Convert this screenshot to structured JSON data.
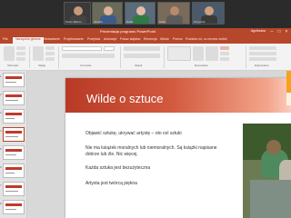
{
  "window": {
    "title": "Prezentacja programu PowerPoint",
    "user": "Agnieszka"
  },
  "videos": [
    {
      "name": "Pedro Barros"
    },
    {
      "name": "Joanna"
    },
    {
      "name": "Rafał"
    },
    {
      "name": "Dalia"
    },
    {
      "name": "Krzysztof"
    }
  ],
  "menu": {
    "tabs": [
      "Plik",
      "Narzędzia główne",
      "Wstawianie",
      "Projektowanie",
      "Przejścia",
      "Animacje",
      "Pokaz slajdów",
      "Recenzja",
      "Widok",
      "Pomoc",
      "Powiedz mi, co chcesz zrobić"
    ]
  },
  "ribbon": {
    "groups": [
      "Schowek",
      "Slajdy",
      "Czcionka",
      "Akapit",
      "Rysowanie",
      "Edytowanie"
    ]
  },
  "thumbnails": [
    "1",
    "2",
    "3",
    "4",
    "5",
    "6",
    "7",
    "8"
  ],
  "slide": {
    "title": "Wilde o sztuce",
    "bullets": [
      "Objawić sztukę, ukrywać artystę – oto cel sztuki",
      "Nie ma książek moralnych lub niemoralnych. Są książki napisane dobrze lub źle. Nic więcej.",
      "Każda sztuka jest bezużyteczna",
      "Artysta jest twórcą piękna"
    ]
  }
}
